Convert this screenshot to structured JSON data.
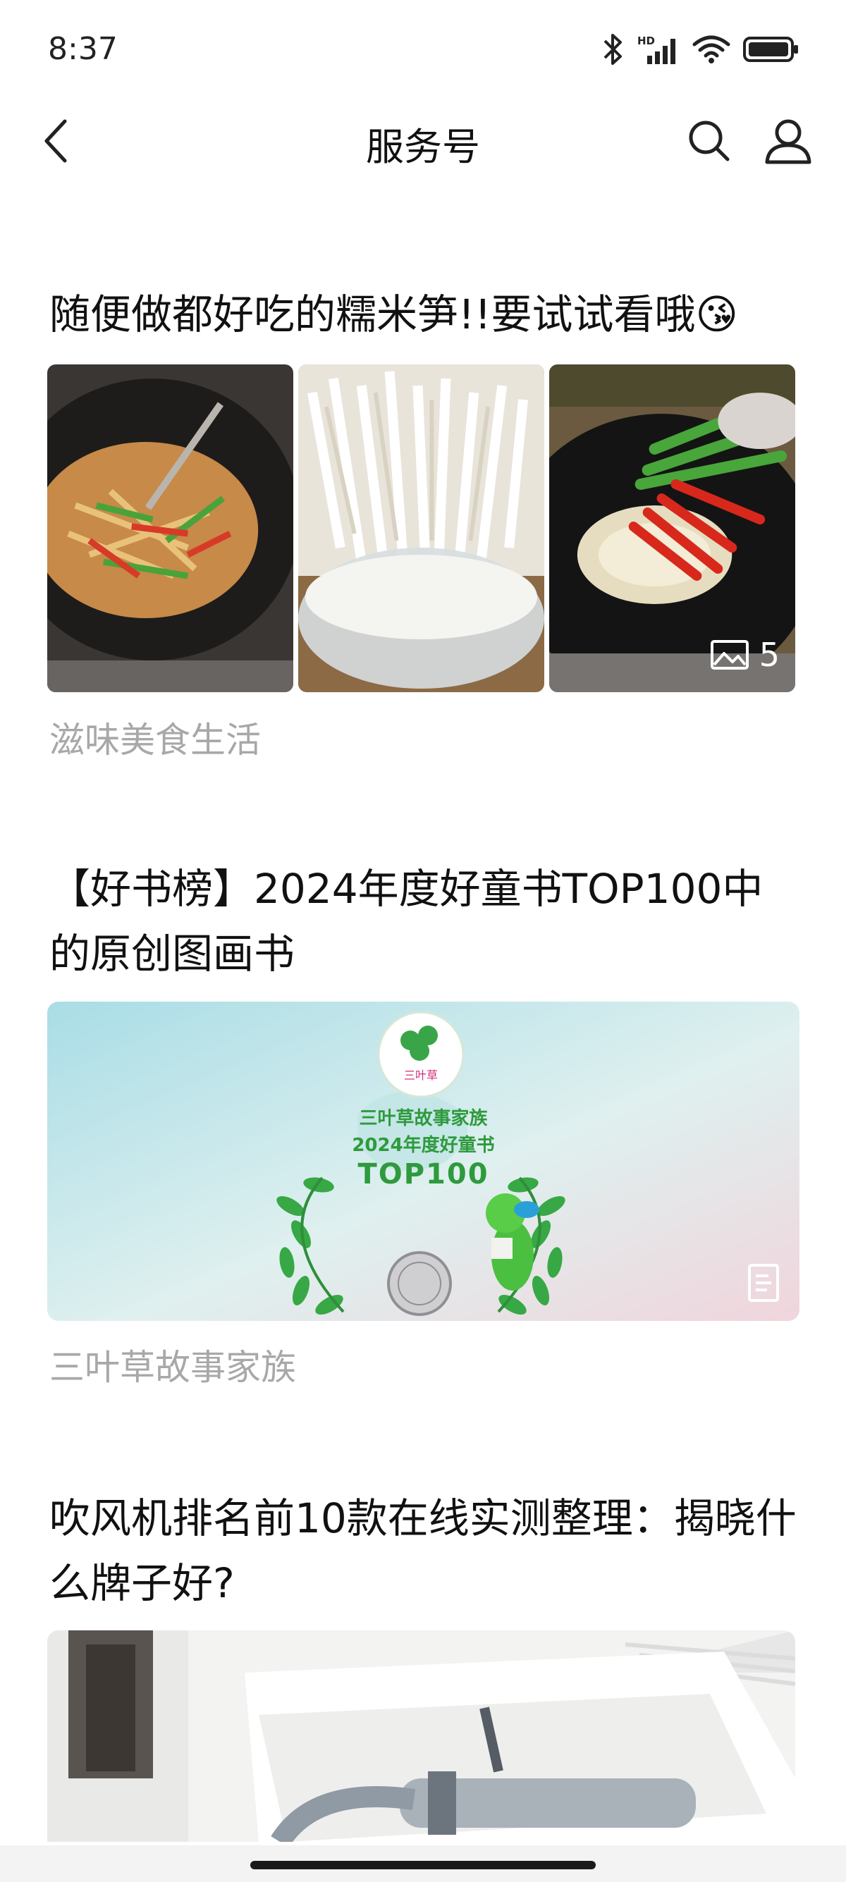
{
  "status_bar": {
    "time": "8:37",
    "network_label": "HD"
  },
  "nav": {
    "title": "服务号"
  },
  "articles": [
    {
      "title": "随便做都好吃的糯米笋!!要试试看哦😘",
      "source": "滋味美食生活",
      "image_count": "5"
    },
    {
      "title": "【好书榜】2024年度好童书TOP100中的原创图画书",
      "source": "三叶草故事家族",
      "banner": {
        "logo_text": "三叶草",
        "line1": "三叶草故事家族",
        "line2": "2024年度好童书",
        "line3": "TOP100"
      }
    },
    {
      "title": "吹风机排名前10款在线实测整理：揭晓什么牌子好?"
    }
  ]
}
